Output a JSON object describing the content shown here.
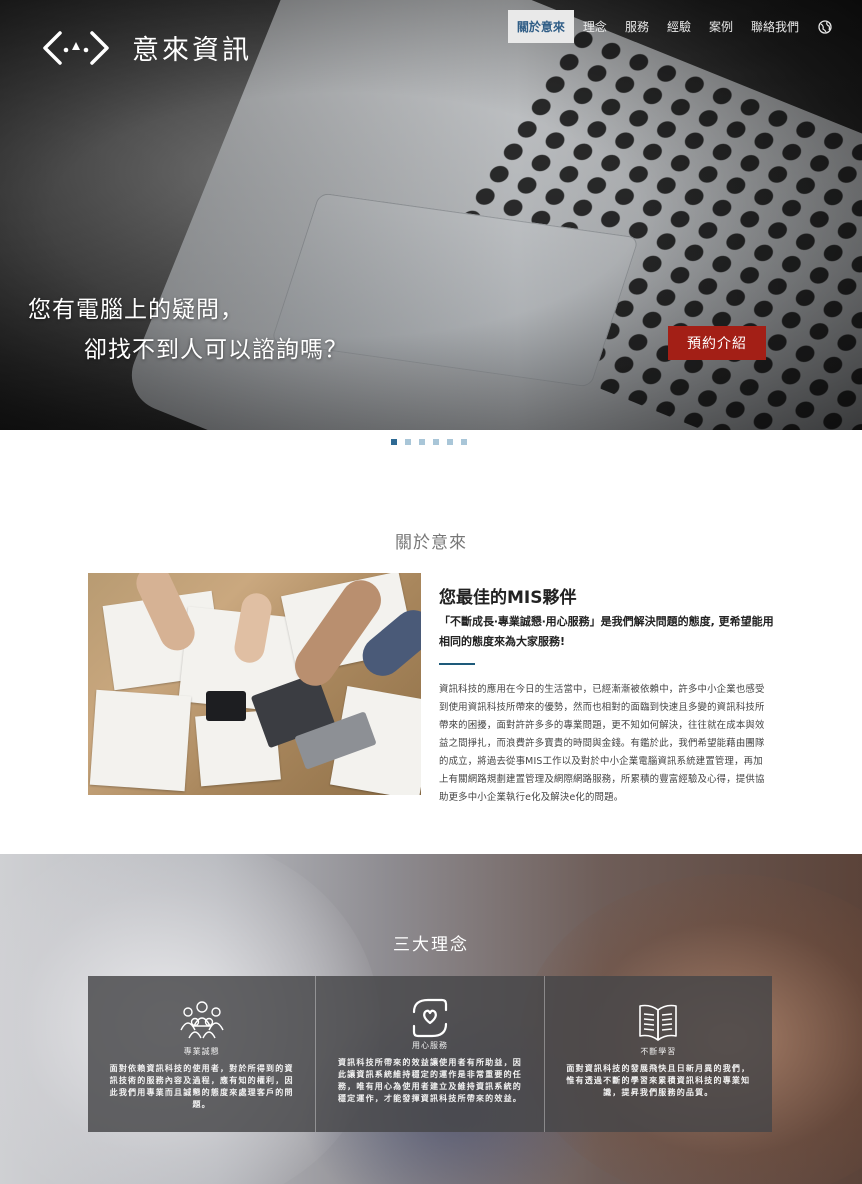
{
  "brand": {
    "name": "意來資訊",
    "logo_icon": "network-brackets-icon"
  },
  "nav": {
    "items": [
      "關於意來",
      "理念",
      "服務",
      "經驗",
      "案例",
      "聯絡我們"
    ],
    "active_index": 0,
    "globe_icon": "globe-icon"
  },
  "hero": {
    "line1": "您有電腦上的疑問，",
    "line2": "卻找不到人可以諮詢嗎？",
    "button_label": "預約介紹",
    "button_color": "#a31f16",
    "slide_count": 6,
    "active_slide": 0
  },
  "about": {
    "section_title": "關於意來",
    "heading": "您最佳的MIS夥伴",
    "subheading": "「不斷成長‧專業誠懇‧用心服務」是我們解決問題的態度, 更希望能用相同的態度來為大家服務!",
    "body": "資訊科技的應用在今日的生活當中，已經漸漸被依賴中，許多中小企業也感受到使用資訊科技所帶來的優勢，然而也相對的面臨到快速且多變的資訊科技所帶來的困擾，面對許許多多的專業問題，更不知如何解決，往往就在成本與效益之間掙扎，而浪費許多寶貴的時間與金錢。有鑑於此，我們希望能藉由團隊的成立，將過去從事MIS工作以及對於中小企業電腦資訊系統建置管理，再加上有關網路規劃建置管理及網際網路服務，所累積的豐富經驗及心得，提供協助更多中小企業執行e化及解決e化的問題。",
    "accent_color": "#1e5a7a"
  },
  "philosophy": {
    "section_title": "三大理念",
    "cards": [
      {
        "icon": "people-group-icon",
        "label": "專業誠懇",
        "text": "面對依賴資訊科技的使用者，對於所得到的資訊技術的服務內容及過程，應有知的權利，因此我們用專業而且誠懇的態度來處理客戶的問題。"
      },
      {
        "icon": "hands-heart-icon",
        "label": "用心服務",
        "text": "資訊科技所帶來的效益讓使用者有所助益，因此讓資訊系統維持穩定的運作是非常重要的任務，唯有用心為使用者建立及維持資訊系統的穩定運作，才能發揮資訊科技所帶來的效益。"
      },
      {
        "icon": "open-book-icon",
        "label": "不斷學習",
        "text": "面對資訊科技的發展飛快且日新月異的我們，惟有透過不斷的學習來累積資訊科技的專業知識，提昇我們服務的品質。"
      }
    ]
  }
}
